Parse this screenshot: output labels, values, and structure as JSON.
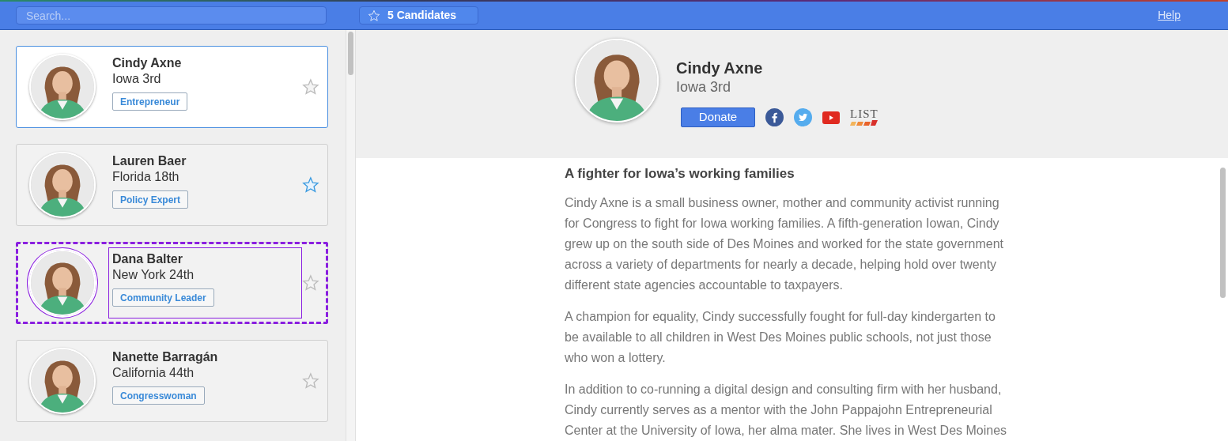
{
  "top_bar": {
    "search": {
      "placeholder": "Search..."
    },
    "candidates_button": "5 Candidates",
    "help_link": "Help"
  },
  "candidates": [
    {
      "name": "Cindy Axne",
      "district": "Iowa 3rd",
      "tag": "Entrepreneur",
      "selected": true,
      "starred": false,
      "highlighted": false
    },
    {
      "name": "Lauren Baer",
      "district": "Florida 18th",
      "tag": "Policy Expert",
      "selected": false,
      "starred": true,
      "highlighted": false
    },
    {
      "name": "Dana Balter",
      "district": "New York 24th",
      "tag": "Community Leader",
      "selected": false,
      "starred": false,
      "highlighted": true
    },
    {
      "name": "Nanette Barragán",
      "district": "California 44th",
      "tag": "Congresswoman",
      "selected": false,
      "starred": false,
      "highlighted": false
    }
  ],
  "profile": {
    "name": "Cindy Axne",
    "district": "Iowa 3rd",
    "donate_button": "Donate",
    "list_logo": "LIST",
    "heading": "A fighter for Iowa’s working families",
    "paragraphs": [
      "Cindy Axne is a small business owner, mother and community activist running for Congress to fight for Iowa working families. A fifth-generation Iowan, Cindy grew up on the south side of Des Moines and worked for the state government across a variety of departments for nearly a decade, helping hold over twenty different state agencies accountable to taxpayers.",
      "A champion for equality, Cindy successfully fought for full-day kindergarten to be available to all children in West Des Moines public schools, not just those who won a lottery.",
      "In addition to co-running a digital design and consulting firm with her husband, Cindy currently serves as a mentor with the John Pappajohn Entrepreneurial Center at the University of Iowa, her alma mater. She lives in West Des Moines"
    ]
  }
}
